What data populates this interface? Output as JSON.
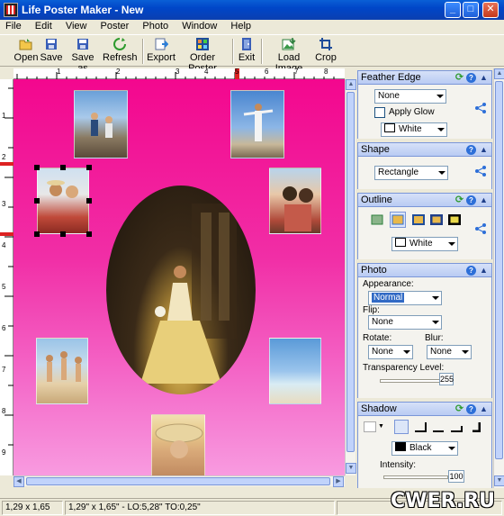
{
  "window": {
    "title": "Life Poster Maker - New"
  },
  "menu": [
    "File",
    "Edit",
    "View",
    "Poster",
    "Photo",
    "Window",
    "Help"
  ],
  "toolbar": {
    "open": "Open",
    "save": "Save",
    "save_as": "Save as",
    "refresh": "Refresh",
    "export": "Export",
    "order_poster": "Order Poster",
    "exit": "Exit",
    "load_image": "Load Image",
    "crop": "Crop"
  },
  "ruler": {
    "h_marks": [
      "1",
      "2",
      "3",
      "4",
      "5",
      "6",
      "7",
      "8"
    ],
    "v_marks": [
      "1",
      "2",
      "3",
      "4",
      "5",
      "6",
      "7",
      "8",
      "9"
    ]
  },
  "panels": {
    "feather_edge": {
      "title": "Feather Edge",
      "mode": "None",
      "apply_glow_label": "Apply Glow",
      "apply_glow": false,
      "glow_color": "White",
      "glow_color_hex": "#ffffff"
    },
    "shape": {
      "title": "Shape",
      "value": "Rectangle"
    },
    "outline": {
      "title": "Outline",
      "color": "White",
      "color_hex": "#ffffff"
    },
    "photo": {
      "title": "Photo",
      "appearance_label": "Appearance:",
      "appearance": "Normal",
      "flip_label": "Flip:",
      "flip": "None",
      "rotate_label": "Rotate:",
      "rotate": "None",
      "blur_label": "Blur:",
      "blur": "None",
      "transparency_label": "Transparency Level:",
      "transparency": "255"
    },
    "shadow": {
      "title": "Shadow",
      "color": "Black",
      "color_hex": "#000000",
      "intensity_label": "Intensity:",
      "intensity": "100"
    }
  },
  "status": {
    "size": "1,29 x 1,65",
    "detail": "1,29\" x 1,65\" - LO:5,28\" TO:0,25\""
  },
  "watermark": "CWER.RU",
  "colors": {
    "poster_top": "#f3078e",
    "poster_bottom": "#f89be0",
    "titlebar": "#0a5fd6",
    "panel_header": "#c6d5f5"
  }
}
